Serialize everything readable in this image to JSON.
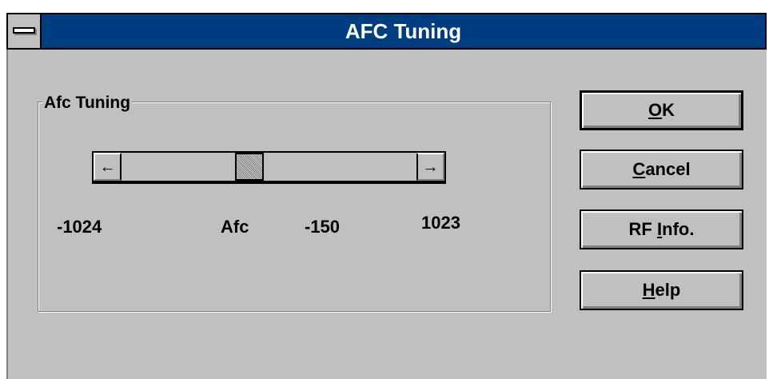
{
  "window": {
    "title": "AFC Tuning"
  },
  "group": {
    "label": "Afc Tuning"
  },
  "slider": {
    "min_label": "-1024",
    "max_label": "1023",
    "name_label": "Afc",
    "value_label": "-150",
    "min": -1024,
    "max": 1023,
    "value": -150,
    "left_arrow": "←",
    "right_arrow": "→"
  },
  "buttons": {
    "ok": {
      "mnemonic": "O",
      "rest": "K"
    },
    "cancel": {
      "mnemonic": "C",
      "rest": "ancel"
    },
    "rfinfo": {
      "pre": "RF ",
      "mnemonic": "I",
      "rest": "nfo."
    },
    "help": {
      "mnemonic": "H",
      "rest": "elp"
    }
  }
}
